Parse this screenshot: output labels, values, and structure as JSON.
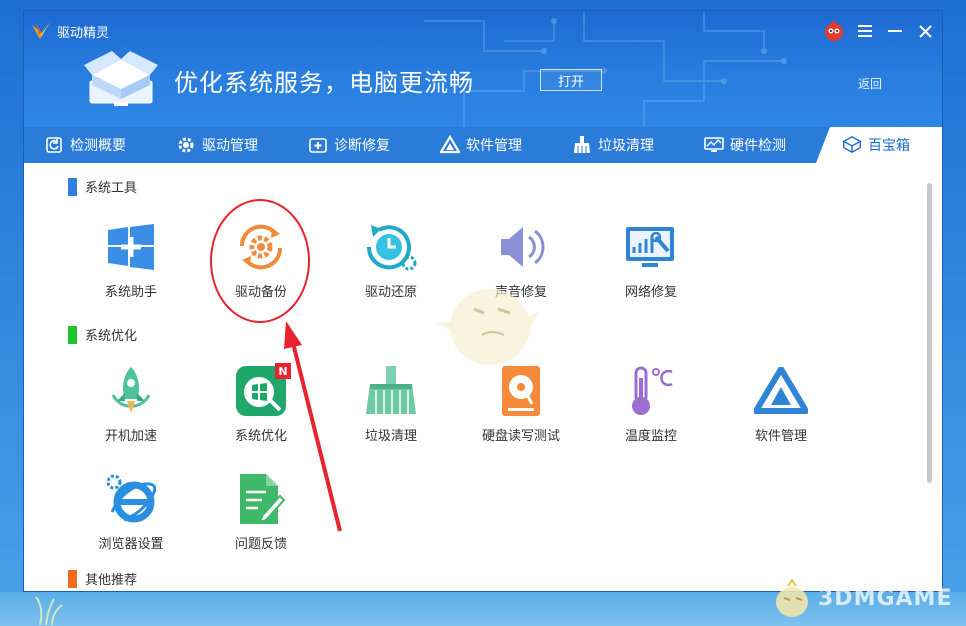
{
  "app": {
    "name": "驱动精灵"
  },
  "banner": {
    "slogan": "优化系统服务，电脑更流畅",
    "open_label": "打开",
    "back_label": "返回"
  },
  "tabs": [
    {
      "label": "检测概要",
      "icon": "refresh-icon"
    },
    {
      "label": "驱动管理",
      "icon": "gear-icon"
    },
    {
      "label": "诊断修复",
      "icon": "medkit-icon"
    },
    {
      "label": "软件管理",
      "icon": "triangle-icon"
    },
    {
      "label": "垃圾清理",
      "icon": "broom-icon"
    },
    {
      "label": "硬件检测",
      "icon": "monitor-icon"
    },
    {
      "label": "百宝箱",
      "icon": "box-icon",
      "active": true
    }
  ],
  "sections": {
    "system_tools": {
      "title": "系统工具",
      "color": "#2f7ee0"
    },
    "system_optimize": {
      "title": "系统优化",
      "color": "#1fc32a"
    },
    "other": {
      "title": "其他推荐",
      "color": "#f26b1d"
    }
  },
  "tools": {
    "system_helper": "系统助手",
    "driver_backup": "驱动备份",
    "driver_restore": "驱动还原",
    "sound_repair": "声音修复",
    "network_repair": "网络修复",
    "boot_speedup": "开机加速",
    "system_optimize": "系统优化",
    "junk_clean": "垃圾清理",
    "disk_rw_test": "硬盘读写测试",
    "temp_monitor": "温度监控",
    "software_manage": "软件管理",
    "browser_settings": "浏览器设置",
    "feedback": "问题反馈"
  },
  "badges": {
    "system_optimize": "N"
  },
  "watermark": {
    "text": "3DMGAME"
  },
  "colors": {
    "accent": "#2b7bd8",
    "highlight": "#e8232f"
  }
}
